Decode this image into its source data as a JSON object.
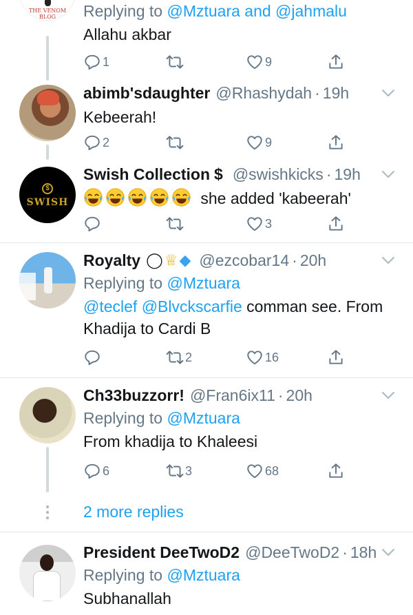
{
  "colors": {
    "link": "#1da1f2",
    "secondary": "#657786",
    "text": "#14171a",
    "divider": "#e1e8ed"
  },
  "tweet1": {
    "avatar_caption": "THE VENOM BLOG",
    "reply_prefix": "Replying to ",
    "reply_users": "@Mztuara and @jahmalu",
    "text": "Allahu akbar",
    "replies": "1",
    "retweets": "",
    "likes": "9"
  },
  "tweet2": {
    "name": "abimb'sdaughter",
    "handle": "@Rhashydah",
    "time": "19h",
    "text": "Kebeerah!",
    "replies": "2",
    "retweets": "",
    "likes": "9"
  },
  "tweet3": {
    "name": "Swish Collection",
    "name_symbol": "$",
    "handle": "@swishkicks",
    "time": "19h",
    "avatar_text": "SWISH",
    "emoji_icon": "tears-of-joy-emoji",
    "text": "she added 'kabeerah'",
    "replies": "",
    "retweets": "",
    "likes": "3"
  },
  "tweet4": {
    "name": "Royalty",
    "name_emojis": [
      "ghost-emoji",
      "crown-emoji",
      "diamond-emoji"
    ],
    "handle": "@ezcobar14",
    "time": "20h",
    "reply_prefix": "Replying to ",
    "reply_users": "@Mztuara",
    "mentions": "@teclef @Blvckscarfie",
    "text": " comman see. From Khadija to Cardi B",
    "replies": "",
    "retweets": "2",
    "likes": "16"
  },
  "tweet5": {
    "name": "Ch33buzzorr!",
    "handle": "@Fran6ix11",
    "time": "20h",
    "reply_prefix": "Replying to ",
    "reply_users": "@Mztuara",
    "text": "From khadija to Khaleesi",
    "replies": "6",
    "retweets": "3",
    "likes": "68"
  },
  "more_replies": "2 more replies",
  "tweet6": {
    "name": "President DeeTwoD2",
    "handle": "@DeeTwoD2",
    "time": "18h",
    "reply_prefix": "Replying to ",
    "reply_users": "@Mztuara",
    "text": "Subhanallah"
  },
  "dot": "·"
}
